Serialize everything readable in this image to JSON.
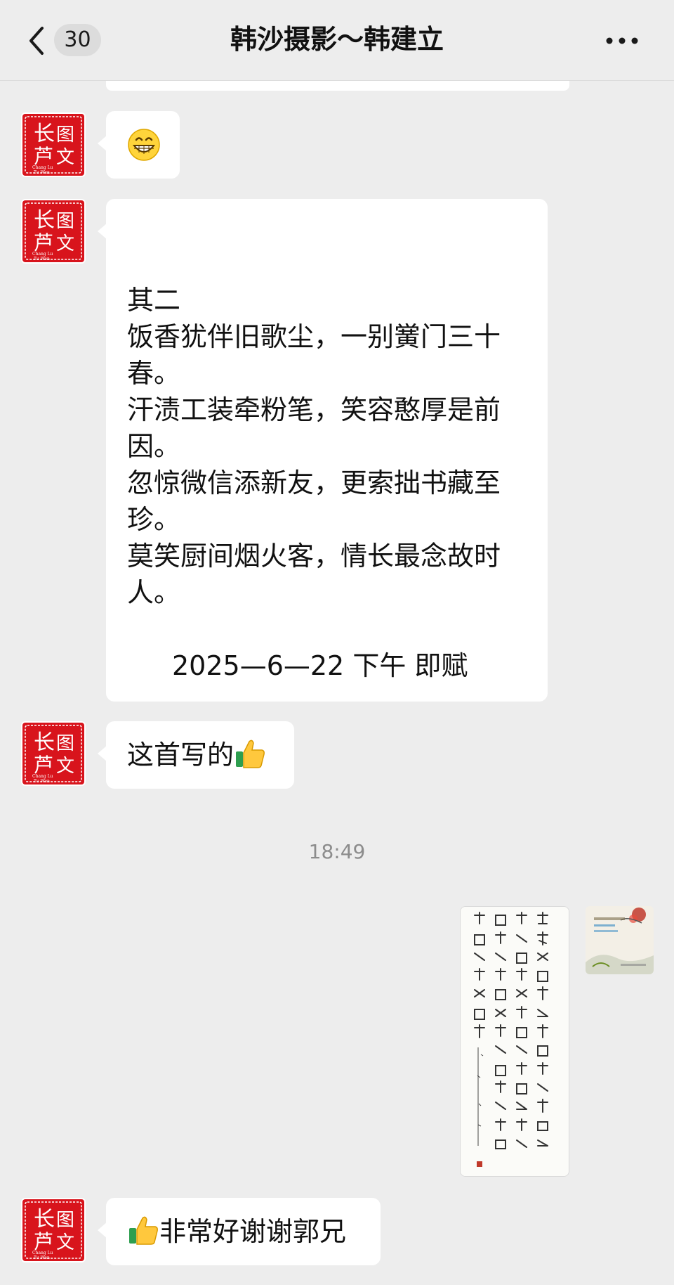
{
  "header": {
    "unread_count": "30",
    "title": "韩沙摄影～韩建立"
  },
  "avatar": {
    "seal_glyphs": [
      "长",
      "图",
      "芦",
      "文"
    ],
    "seal_caption": [
      "Chang Lu",
      "Tu Wen"
    ]
  },
  "messages": [
    {
      "type": "emoji",
      "sender": "other",
      "emoji": "grinning-face"
    },
    {
      "type": "text",
      "sender": "other",
      "lines": [
        "其二",
        "饭香犹伴旧歌尘，一别黉门三十春。",
        "汗渍工装牵粉笔，笑容憨厚是前因。",
        "忽惊微信添新友，更索拙书藏至珍。",
        "莫笑厨间烟火客，情长最念故时人。"
      ],
      "date_line": "2025—6—22 下午 即赋"
    },
    {
      "type": "text",
      "sender": "other",
      "text": "这首写的",
      "suffix_emoji": "thumbs-up"
    },
    {
      "type": "time",
      "text": "18:49"
    },
    {
      "type": "image",
      "sender": "me",
      "description": "calligraphy scroll"
    },
    {
      "type": "text",
      "sender": "other",
      "prefix_emoji": "thumbs-up",
      "text": "非常好谢谢郭兄"
    }
  ],
  "colors": {
    "background": "#ededed",
    "bubble": "#ffffff",
    "seal_red": "#d8141c",
    "timestamp": "#8c8c8c"
  }
}
